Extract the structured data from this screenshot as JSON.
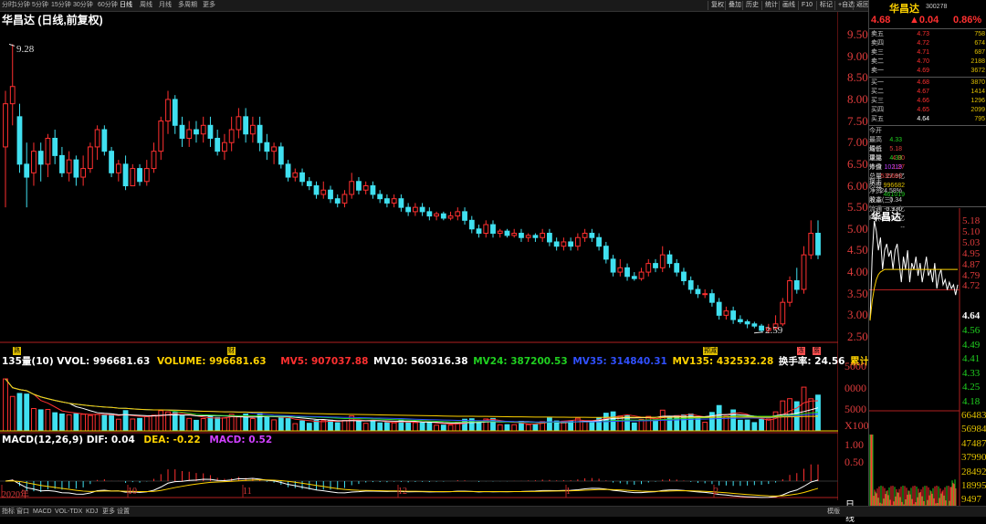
{
  "toolbar": {
    "left_items": [
      "分时",
      "1分钟",
      "5分钟",
      "15分钟",
      "30分钟",
      "60分钟",
      "日线",
      "周线",
      "月线",
      "多周期",
      "更多"
    ],
    "active": "日线",
    "right_items": [
      "复权",
      "叠加",
      "历史",
      "统计",
      "画线",
      "F10",
      "标记",
      "+自选",
      "返回"
    ]
  },
  "chart": {
    "title": "华昌达 (日线,前复权)",
    "high_label": "9.28",
    "low_label": "2.59",
    "price_axis": [
      "9.50",
      "9.00",
      "8.50",
      "8.00",
      "7.50",
      "7.00",
      "6.50",
      "6.00",
      "5.50",
      "5.00",
      "4.50",
      "4.00",
      "3.50",
      "3.00",
      "2.50"
    ],
    "markers": [
      {
        "text": "熟",
        "color": "#e0c000"
      },
      {
        "text": "财",
        "color": "#e0c000"
      },
      {
        "text": "预减",
        "color": "#e0c000"
      },
      {
        "text": "冻",
        "color": "#ff5050"
      },
      {
        "text": "质",
        "color": "#ff5050"
      }
    ],
    "candles": [
      [
        6.9,
        7.9,
        7.1,
        8.2,
        5.5
      ],
      [
        7.9,
        8.3,
        7.7,
        9.28,
        7.4
      ],
      [
        7.6,
        6.5,
        7.8,
        7.9,
        6.3
      ],
      [
        6.5,
        6.2,
        6.6,
        7.0,
        5.5
      ],
      [
        6.3,
        6.8,
        6.2,
        7.0,
        6.0
      ],
      [
        6.8,
        6.5,
        6.9,
        7.0,
        6.1
      ],
      [
        6.5,
        7.1,
        6.4,
        7.2,
        6.2
      ],
      [
        7.1,
        6.7,
        7.2,
        7.3,
        6.5
      ],
      [
        6.7,
        6.3,
        6.8,
        6.9,
        6.2
      ],
      [
        6.3,
        6.6,
        6.2,
        6.8,
        6.1
      ],
      [
        6.6,
        6.2,
        6.7,
        6.7,
        6.0
      ],
      [
        6.2,
        6.4,
        6.1,
        6.7,
        6.0
      ],
      [
        6.4,
        6.9,
        6.3,
        7.0,
        6.3
      ],
      [
        6.9,
        7.3,
        6.8,
        7.4,
        6.6
      ],
      [
        7.3,
        6.8,
        7.4,
        7.4,
        6.7
      ],
      [
        6.8,
        6.3,
        6.9,
        6.9,
        6.2
      ],
      [
        6.3,
        6.5,
        6.2,
        6.6,
        6.1
      ],
      [
        6.5,
        6.0,
        6.6,
        6.7,
        5.9
      ],
      [
        6.0,
        6.4,
        6.0,
        6.5,
        6.0
      ],
      [
        6.4,
        6.1,
        6.5,
        6.5,
        6.0
      ],
      [
        6.1,
        6.4,
        6.1,
        6.6,
        6.0
      ],
      [
        6.4,
        6.8,
        6.3,
        7.0,
        6.3
      ],
      [
        6.8,
        7.5,
        6.7,
        7.6,
        6.6
      ],
      [
        7.5,
        8.0,
        7.4,
        8.2,
        7.2
      ],
      [
        8.0,
        7.4,
        8.1,
        8.1,
        7.2
      ],
      [
        7.4,
        7.1,
        7.5,
        7.6,
        6.9
      ],
      [
        7.1,
        7.3,
        7.1,
        7.5,
        6.9
      ],
      [
        7.3,
        7.2,
        7.4,
        7.5,
        7.0
      ],
      [
        7.2,
        7.4,
        7.1,
        7.6,
        7.0
      ],
      [
        7.4,
        7.1,
        7.5,
        7.6,
        6.9
      ],
      [
        7.1,
        6.8,
        7.2,
        7.3,
        6.7
      ],
      [
        6.8,
        7.0,
        6.8,
        7.2,
        6.6
      ],
      [
        7.0,
        7.3,
        6.9,
        7.6,
        6.8
      ],
      [
        7.3,
        7.6,
        7.2,
        7.8,
        7.1
      ],
      [
        7.6,
        7.2,
        7.7,
        7.8,
        7.0
      ],
      [
        7.2,
        7.4,
        7.1,
        7.6,
        7.0
      ],
      [
        7.4,
        7.0,
        7.5,
        7.6,
        6.8
      ],
      [
        7.0,
        6.8,
        7.1,
        7.2,
        6.6
      ],
      [
        6.8,
        6.9,
        6.7,
        7.0,
        6.5
      ],
      [
        6.9,
        6.5,
        7.0,
        7.0,
        6.4
      ],
      [
        6.5,
        6.2,
        6.6,
        6.6,
        6.1
      ],
      [
        6.2,
        6.3,
        6.1,
        6.4,
        6.1
      ],
      [
        6.3,
        6.1,
        6.4,
        6.4,
        6.0
      ],
      [
        6.1,
        6.0,
        6.2,
        6.2,
        5.9
      ],
      [
        6.0,
        5.8,
        6.1,
        6.1,
        5.7
      ],
      [
        5.8,
        5.9,
        5.7,
        6.1,
        5.7
      ],
      [
        5.9,
        5.7,
        6.0,
        6.0,
        5.6
      ],
      [
        5.7,
        5.6,
        5.8,
        5.8,
        5.5
      ],
      [
        5.6,
        5.8,
        5.5,
        5.9,
        5.5
      ],
      [
        5.8,
        6.1,
        5.7,
        6.3,
        5.7
      ],
      [
        6.1,
        5.9,
        6.2,
        6.2,
        5.8
      ],
      [
        5.9,
        6.0,
        5.8,
        6.1,
        5.8
      ],
      [
        6.0,
        5.8,
        6.1,
        6.1,
        5.7
      ],
      [
        5.8,
        5.7,
        5.9,
        5.9,
        5.6
      ],
      [
        5.7,
        5.6,
        5.8,
        5.8,
        5.5
      ],
      [
        5.6,
        5.7,
        5.5,
        5.8,
        5.5
      ],
      [
        5.7,
        5.5,
        5.8,
        5.8,
        5.4
      ],
      [
        5.5,
        5.4,
        5.6,
        5.6,
        5.3
      ],
      [
        5.4,
        5.5,
        5.3,
        5.6,
        5.3
      ],
      [
        5.5,
        5.4,
        5.6,
        5.6,
        5.3
      ],
      [
        5.4,
        5.3,
        5.5,
        5.5,
        5.2
      ],
      [
        5.3,
        5.35,
        5.25,
        5.4,
        5.2
      ],
      [
        5.35,
        5.25,
        5.4,
        5.4,
        5.2
      ],
      [
        5.25,
        5.3,
        5.2,
        5.4,
        5.2
      ],
      [
        5.3,
        5.4,
        5.2,
        5.5,
        5.2
      ],
      [
        5.4,
        5.2,
        5.5,
        5.5,
        5.1
      ],
      [
        5.2,
        5.0,
        5.3,
        5.3,
        4.9
      ],
      [
        5.0,
        4.9,
        5.1,
        5.1,
        4.8
      ],
      [
        4.9,
        5.1,
        4.8,
        5.2,
        4.8
      ],
      [
        5.1,
        4.9,
        5.2,
        5.2,
        4.8
      ],
      [
        4.9,
        4.95,
        4.85,
        5.0,
        4.8
      ],
      [
        4.95,
        4.85,
        5.0,
        5.0,
        4.8
      ],
      [
        4.85,
        4.9,
        4.8,
        5.0,
        4.8
      ],
      [
        4.9,
        4.8,
        5.0,
        5.0,
        4.7
      ],
      [
        4.8,
        4.85,
        4.75,
        4.9,
        4.7
      ],
      [
        4.85,
        4.8,
        4.9,
        4.9,
        4.7
      ],
      [
        4.8,
        4.9,
        4.7,
        5.0,
        4.7
      ],
      [
        4.9,
        4.7,
        5.0,
        5.0,
        4.6
      ],
      [
        4.7,
        4.6,
        4.8,
        4.8,
        4.5
      ],
      [
        4.6,
        4.7,
        4.5,
        4.8,
        4.5
      ],
      [
        4.7,
        4.6,
        4.8,
        4.8,
        4.5
      ],
      [
        4.6,
        4.8,
        4.5,
        4.9,
        4.5
      ],
      [
        4.8,
        4.9,
        4.7,
        5.0,
        4.7
      ],
      [
        4.9,
        4.8,
        5.0,
        5.0,
        4.7
      ],
      [
        4.8,
        4.6,
        4.9,
        4.9,
        4.5
      ],
      [
        4.6,
        4.3,
        4.7,
        4.7,
        4.2
      ],
      [
        4.3,
        4.0,
        4.4,
        4.4,
        3.9
      ],
      [
        4.0,
        4.1,
        3.9,
        4.3,
        3.9
      ],
      [
        4.1,
        3.9,
        4.2,
        4.2,
        3.8
      ],
      [
        3.9,
        3.85,
        4.0,
        4.0,
        3.8
      ],
      [
        3.85,
        4.0,
        3.8,
        4.1,
        3.8
      ],
      [
        4.0,
        4.2,
        3.9,
        4.3,
        3.9
      ],
      [
        4.2,
        4.1,
        4.3,
        4.3,
        4.0
      ],
      [
        4.1,
        4.4,
        4.0,
        4.6,
        4.0
      ],
      [
        4.4,
        4.2,
        4.5,
        4.5,
        4.1
      ],
      [
        4.2,
        4.0,
        4.3,
        4.3,
        3.9
      ],
      [
        4.0,
        3.8,
        4.1,
        4.1,
        3.7
      ],
      [
        3.8,
        3.6,
        3.9,
        3.9,
        3.5
      ],
      [
        3.6,
        3.5,
        3.7,
        3.7,
        3.4
      ],
      [
        3.5,
        3.5,
        3.6,
        3.6,
        3.4
      ],
      [
        3.5,
        3.3,
        3.6,
        3.6,
        3.2
      ],
      [
        3.3,
        3.0,
        3.4,
        3.4,
        2.9
      ],
      [
        3.0,
        3.1,
        2.9,
        3.2,
        2.9
      ],
      [
        3.1,
        2.9,
        3.2,
        3.2,
        2.8
      ],
      [
        2.9,
        2.85,
        3.0,
        3.0,
        2.8
      ],
      [
        2.85,
        2.8,
        2.9,
        2.9,
        2.7
      ],
      [
        2.8,
        2.75,
        2.85,
        2.85,
        2.7
      ],
      [
        2.75,
        2.65,
        2.8,
        2.8,
        2.6
      ],
      [
        2.65,
        2.7,
        2.59,
        2.8,
        2.59
      ],
      [
        2.7,
        2.8,
        2.65,
        3.0,
        2.65
      ],
      [
        2.8,
        3.3,
        2.75,
        3.4,
        2.75
      ],
      [
        3.3,
        3.8,
        3.2,
        3.9,
        3.2
      ],
      [
        3.8,
        3.6,
        3.9,
        4.1,
        3.5
      ],
      [
        3.6,
        4.4,
        3.5,
        4.6,
        3.5
      ],
      [
        4.4,
        4.9,
        4.3,
        5.2,
        4.3
      ],
      [
        4.9,
        4.4,
        4.9,
        5.2,
        4.3
      ]
    ],
    "dates": [
      {
        "text": "2020年",
        "color": "#e03c3c"
      },
      {
        "text": "10",
        "color": "#e03c3c"
      },
      {
        "text": "11",
        "color": "#e03c3c"
      },
      {
        "text": "12",
        "color": "#e03c3c"
      },
      {
        "text": "1",
        "color": "#e03c3c"
      },
      {
        "text": "2",
        "color": "#e03c3c"
      }
    ],
    "period_label": "日线"
  },
  "volume": {
    "label": "135量(10)",
    "vvol": "VVOL: 996681.63",
    "volume": "VOLUME: 996681.63",
    "mv5": "MV5: 907037.88",
    "mv10": "MV10: 560316.38",
    "mv24": "MV24: 387200.53",
    "mv35": "MV35: 314840.31",
    "mv135": "MV135: 432532.28",
    "turnover": "换手率: 24.56",
    "cum_turnover": "累计换手:",
    "axis": [
      "5000",
      "0000",
      "5000"
    ],
    "unit": "X100",
    "colors": {
      "vvol": "#ffffff",
      "volume": "#ffd200",
      "mv5": "#ff3030",
      "mv10": "#ffffff",
      "mv24": "#20d020",
      "mv35": "#3050ff",
      "mv135": "#ffd200",
      "turnover": "#ffffff",
      "cum": "#ffd200"
    }
  },
  "macd": {
    "label": "MACD(12,26,9)",
    "dif": "DIF: 0.04",
    "dea": "DEA: -0.22",
    "macd": "MACD: 0.52",
    "axis": [
      "1.00",
      "0.50"
    ]
  },
  "bottom_bar": {
    "items": [
      "指标",
      "窗口",
      "MACD",
      "VOL-TDX",
      "KDJ",
      "更多",
      "设置"
    ],
    "right": "模版"
  },
  "panel": {
    "name": "华昌达",
    "code": "300278",
    "price": "4.68",
    "change": "▲0.04",
    "pct": "0.86%",
    "asks": [
      {
        "label": "卖五",
        "price": "4.73",
        "vol": "758"
      },
      {
        "label": "卖四",
        "price": "4.72",
        "vol": "674"
      },
      {
        "label": "卖三",
        "price": "4.71",
        "vol": "687"
      },
      {
        "label": "卖二",
        "price": "4.70",
        "vol": "2188"
      },
      {
        "label": "卖一",
        "price": "4.69",
        "vol": "3672"
      }
    ],
    "bids": [
      {
        "label": "买一",
        "price": "4.68",
        "vol": "3870"
      },
      {
        "label": "买二",
        "price": "4.67",
        "vol": "1414"
      },
      {
        "label": "买三",
        "price": "4.66",
        "vol": "1296"
      },
      {
        "label": "买四",
        "price": "4.65",
        "vol": "2099"
      },
      {
        "label": "买五",
        "price": "4.64",
        "vol": "795"
      }
    ],
    "stats": [
      {
        "l1": "今开",
        "v1": "4.33",
        "c1": "#20d020",
        "l2": "均价",
        "v2": "4.80",
        "c2": "#e03c3c"
      },
      {
        "l1": "最高",
        "v1": "5.18",
        "c1": "#e03c3c",
        "l2": "量比",
        "v2": "1.27",
        "c2": "#e03c3c"
      },
      {
        "l1": "最低",
        "v1": "4.33",
        "c1": "#20d020",
        "l2": "市值",
        "v2": "27.9亿",
        "c2": "#cccccc"
      },
      {
        "l1": "现量",
        "v1": "10219",
        "c1": "#c040ff",
        "l2": "总量",
        "v2": "996682",
        "c2": "#e0c000"
      },
      {
        "l1": "外盘",
        "v1": "535663",
        "c1": "#e03c3c",
        "l2": "内盘",
        "v2": "461019",
        "c2": "#20d020"
      },
      {
        "l1": "换手",
        "v1": "24.58%",
        "c1": "#cccccc",
        "l2": "股本",
        "v2": "5.97亿",
        "c2": "#cccccc"
      },
      {
        "l1": "净资",
        "v1": "0.34",
        "c1": "#cccccc",
        "l2": "流通",
        "v2": "4.06亿",
        "c2": "#cccccc"
      },
      {
        "l1": "收益(三)",
        "v1": "-0.130",
        "c1": "#cccccc",
        "l2": "PE(动)",
        "v2": "--",
        "c2": "#cccccc"
      }
    ],
    "mini_title": "华昌达",
    "mini_axis_red": [
      "5.18",
      "5.10",
      "5.03",
      "4.95",
      "4.87",
      "4.79",
      "4.72"
    ],
    "mini_mid": "4.64",
    "mini_axis_green": [
      "4.56",
      "4.49",
      "4.41",
      "4.33",
      "4.25",
      "4.18"
    ],
    "mini_vol_axis": [
      "66483",
      "56984",
      "47487",
      "37990",
      "28492",
      "18995",
      "9497"
    ],
    "mini_price_series": [
      4.4,
      4.9,
      5.18,
      5.1,
      4.95,
      5.05,
      4.8,
      4.95,
      5.0,
      4.9,
      4.95,
      4.8,
      4.95,
      5.0,
      4.85,
      4.7,
      4.9,
      4.8,
      4.95,
      4.7,
      4.85,
      4.8,
      4.9,
      4.75,
      4.85,
      4.7,
      4.8,
      4.9,
      4.75,
      4.8,
      4.7,
      4.85,
      4.65,
      4.75,
      4.8,
      4.68,
      4.72,
      4.64,
      4.7,
      4.65,
      4.68,
      4.6,
      4.68
    ],
    "mini_avg_series": [
      4.4,
      4.55,
      4.65,
      4.72,
      4.76,
      4.78,
      4.79,
      4.8,
      4.8,
      4.8,
      4.8,
      4.8,
      4.8,
      4.8,
      4.8,
      4.8,
      4.8,
      4.8,
      4.8,
      4.8,
      4.8,
      4.8,
      4.8,
      4.8,
      4.8,
      4.8,
      4.8,
      4.8,
      4.8,
      4.8,
      4.8,
      4.8,
      4.8,
      4.8,
      4.8,
      4.8,
      4.8,
      4.8,
      4.8,
      4.8,
      4.8,
      4.8,
      4.8
    ]
  }
}
